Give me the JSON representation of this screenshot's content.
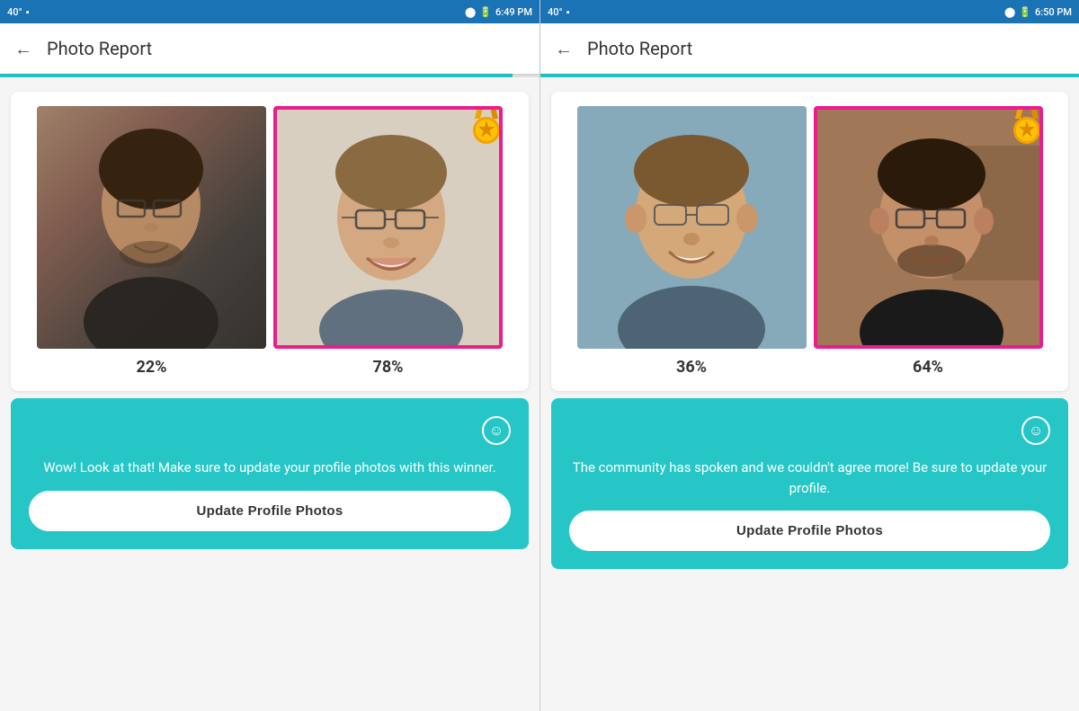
{
  "panels": [
    {
      "id": "panel-1",
      "statusBar": {
        "left": "40°",
        "right": "🔵 4G 39% 6:49 PM"
      },
      "progressWidth": "95%",
      "appBar": {
        "backLabel": "←",
        "title": "Photo Report"
      },
      "photo1": {
        "percentage": "22%",
        "isWinner": false
      },
      "photo2": {
        "percentage": "78%",
        "isWinner": true
      },
      "smileyIcon": "☺",
      "message": "Wow! Look at that! Make sure to update your profile photos with this winner.",
      "buttonLabel": "Update Profile Photos"
    },
    {
      "id": "panel-2",
      "statusBar": {
        "left": "40°",
        "right": "🔵 39% 6:50 PM"
      },
      "progressWidth": "100%",
      "appBar": {
        "backLabel": "←",
        "title": "Photo Report"
      },
      "photo1": {
        "percentage": "36%",
        "isWinner": false
      },
      "photo2": {
        "percentage": "64%",
        "isWinner": true
      },
      "smileyIcon": "☺",
      "message": "The community has spoken and we couldn't agree more! Be sure to update your profile.",
      "buttonLabel": "Update Profile Photos"
    }
  ],
  "colors": {
    "teal": "#26c6c6",
    "pink": "#e91e8c",
    "statusBarBg": "#1a73b5"
  }
}
